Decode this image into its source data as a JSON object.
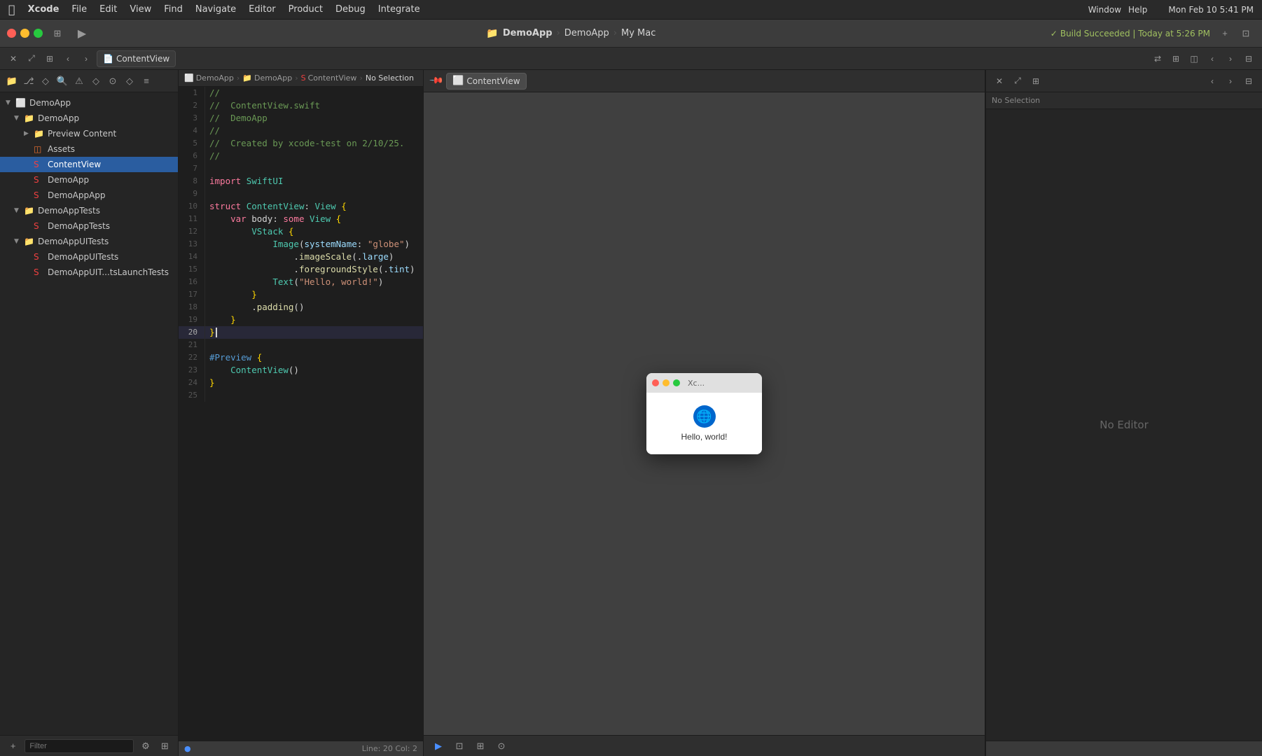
{
  "menubar": {
    "apple": "⌘",
    "items": [
      "Xcode",
      "File",
      "Edit",
      "View",
      "Find",
      "Navigate",
      "Editor",
      "Product",
      "Debug",
      "Integrate",
      "Window",
      "Help"
    ],
    "right": {
      "time": "Mon Feb 10  5:41 PM"
    }
  },
  "titlebar": {
    "project": "DemoApp",
    "schema": "DemoApp",
    "device": "My Mac",
    "build_status": "Build Succeeded | Today at 5:26 PM"
  },
  "tab": {
    "label": "ContentView",
    "icon": "📄"
  },
  "breadcrumb": {
    "parts": [
      "DemoApp",
      "DemoApp",
      "ContentView",
      "No Selection"
    ]
  },
  "sidebar": {
    "items": [
      {
        "label": "DemoApp",
        "level": 0,
        "type": "project",
        "expanded": true
      },
      {
        "label": "DemoApp",
        "level": 1,
        "type": "folder",
        "expanded": true
      },
      {
        "label": "Preview Content",
        "level": 2,
        "type": "folder",
        "expanded": false
      },
      {
        "label": "Assets",
        "level": 2,
        "type": "assets",
        "expanded": false
      },
      {
        "label": "ContentView",
        "level": 2,
        "type": "swift",
        "expanded": false,
        "selected": true
      },
      {
        "label": "DemoApp",
        "level": 2,
        "type": "swift",
        "expanded": false
      },
      {
        "label": "DemoAppApp",
        "level": 2,
        "type": "swift",
        "expanded": false
      },
      {
        "label": "DemoAppTests",
        "level": 1,
        "type": "folder",
        "expanded": true
      },
      {
        "label": "DemoAppTests",
        "level": 2,
        "type": "swift",
        "expanded": false
      },
      {
        "label": "DemoAppUITests",
        "level": 1,
        "type": "folder",
        "expanded": true
      },
      {
        "label": "DemoAppUITests",
        "level": 2,
        "type": "swift",
        "expanded": false
      },
      {
        "label": "DemoAppUIT...tsLaunchTests",
        "level": 2,
        "type": "swift",
        "expanded": false
      }
    ],
    "filter_placeholder": "Filter"
  },
  "code": {
    "lines": [
      {
        "num": 1,
        "content": "//",
        "type": "comment"
      },
      {
        "num": 2,
        "content": "//  ContentView.swift",
        "type": "comment"
      },
      {
        "num": 3,
        "content": "//  DemoApp",
        "type": "comment"
      },
      {
        "num": 4,
        "content": "//",
        "type": "comment"
      },
      {
        "num": 5,
        "content": "//  Created by xcode-test on 2/10/25.",
        "type": "comment"
      },
      {
        "num": 6,
        "content": "//",
        "type": "comment"
      },
      {
        "num": 7,
        "content": "",
        "type": "plain"
      },
      {
        "num": 8,
        "content": "import SwiftUI",
        "type": "import"
      },
      {
        "num": 9,
        "content": "",
        "type": "plain"
      },
      {
        "num": 10,
        "content": "struct ContentView: View {",
        "type": "struct"
      },
      {
        "num": 11,
        "content": "    var body: some View {",
        "type": "var"
      },
      {
        "num": 12,
        "content": "        VStack {",
        "type": "call"
      },
      {
        "num": 13,
        "content": "            Image(systemName: \"globe\")",
        "type": "call"
      },
      {
        "num": 14,
        "content": "                .imageScale(.large)",
        "type": "modifier"
      },
      {
        "num": 15,
        "content": "                .foregroundStyle(.tint)",
        "type": "modifier"
      },
      {
        "num": 16,
        "content": "            Text(\"Hello, world!\")",
        "type": "call"
      },
      {
        "num": 17,
        "content": "        }",
        "type": "plain"
      },
      {
        "num": 18,
        "content": "        .padding()",
        "type": "modifier"
      },
      {
        "num": 19,
        "content": "    }",
        "type": "plain"
      },
      {
        "num": 20,
        "content": "}",
        "type": "cursor",
        "cursor": true
      },
      {
        "num": 21,
        "content": "",
        "type": "plain"
      },
      {
        "num": 22,
        "content": "#Preview {",
        "type": "preview"
      },
      {
        "num": 23,
        "content": "    ContentView()",
        "type": "call"
      },
      {
        "num": 24,
        "content": "}",
        "type": "plain"
      },
      {
        "num": 25,
        "content": "",
        "type": "plain"
      }
    ]
  },
  "preview": {
    "tab_label": "ContentView",
    "mini_window": {
      "title": "Xc...",
      "globe_icon": "🌐",
      "hello_text": "Hello, world!"
    }
  },
  "inspector": {
    "no_editor": "No Editor",
    "no_selection": "No Selection"
  },
  "statusbar": {
    "left": "",
    "right": "Line: 20  Col: 2"
  }
}
